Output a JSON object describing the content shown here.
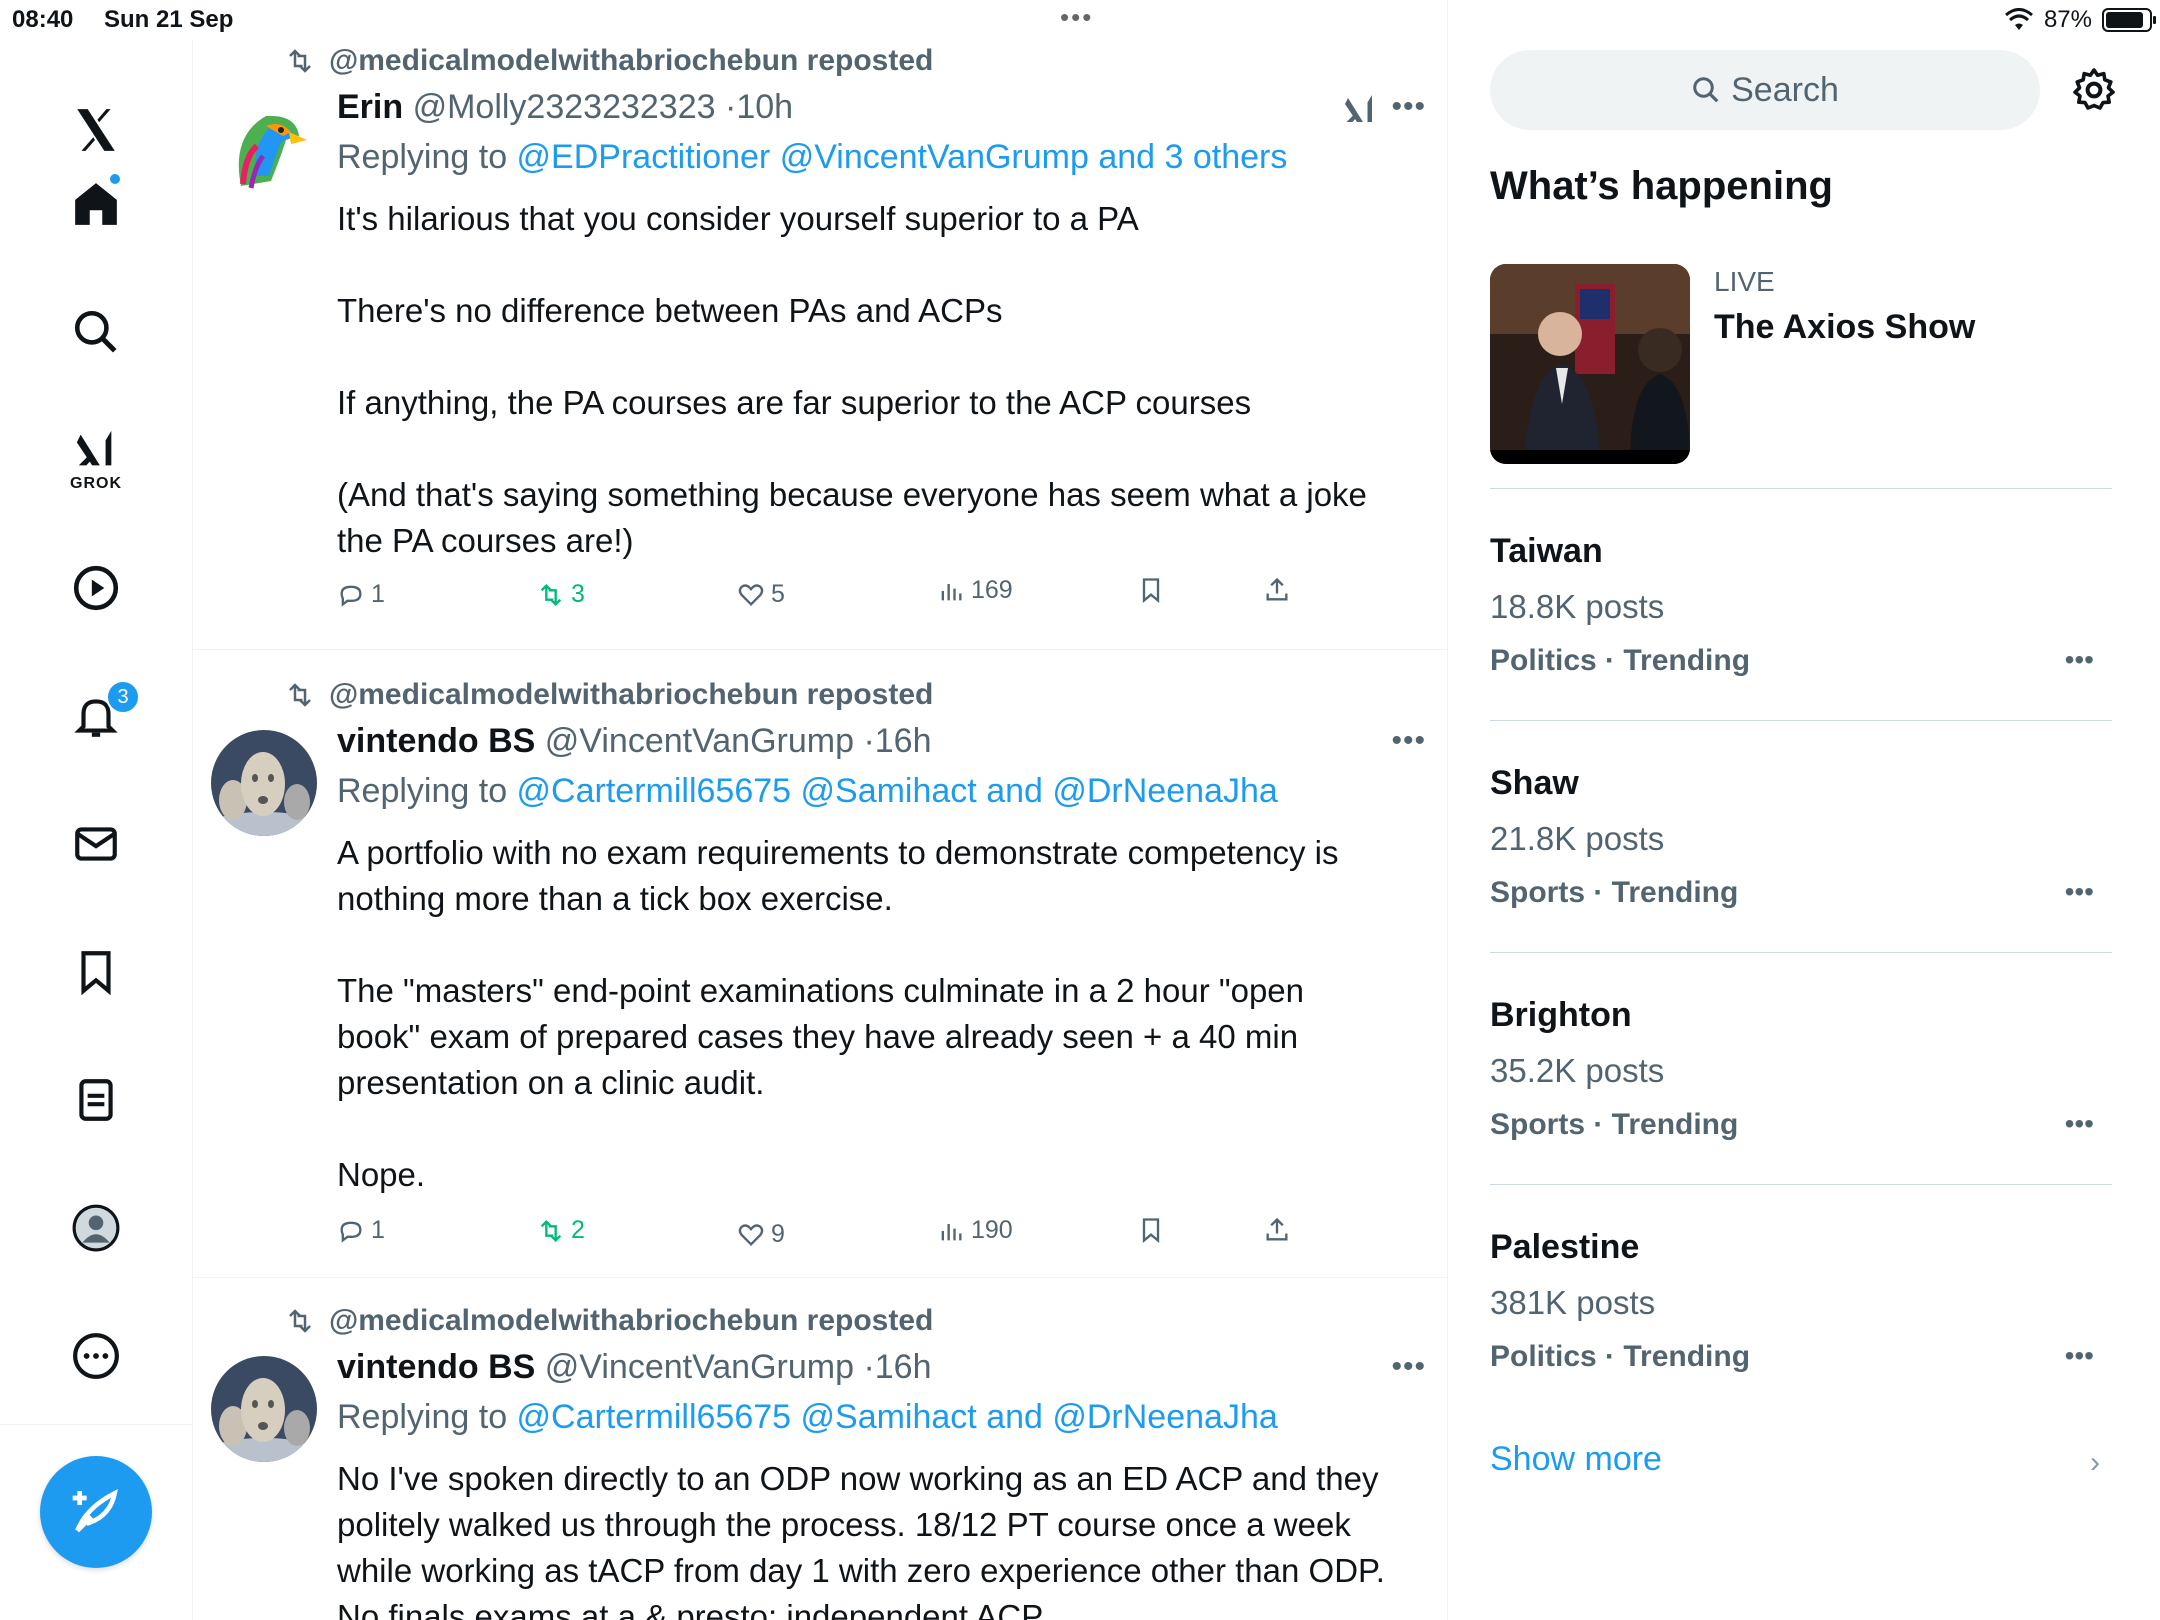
{
  "status_bar": {
    "time": "08:40",
    "date": "Sun 21 Sep",
    "battery": "87%",
    "battery_level": 0.87
  },
  "nav": {
    "grok_label": "GROK",
    "notifications_badge": "3",
    "accent_color": "#1d9bf0"
  },
  "tweets": [
    {
      "repost_label": "@medicalmodelwithabriochebun reposted",
      "name": "Erin",
      "handle": "@Molly2323232323",
      "time": "10h",
      "replying_prefix": "Replying to ",
      "replying_to": "@EDPractitioner @VincentVanGrump and 3 others",
      "text": "It's hilarious that you consider yourself superior to a PA\n\nThere's no difference between PAs and ACPs\n\nIf anything, the PA courses are far superior to the ACP courses\n\n(And that's saying something because everyone has seem what a joke\nthe PA courses are!)",
      "replies": "1",
      "reposts": "3",
      "likes": "5",
      "views": "169"
    },
    {
      "repost_label": "@medicalmodelwithabriochebun reposted",
      "name": "vintendo BS",
      "handle": "@VincentVanGrump",
      "time": "16h",
      "replying_prefix": "Replying to ",
      "replying_to": "@Cartermill65675 @Samihact and @DrNeenaJha",
      "text": "A portfolio with no exam requirements to demonstrate competency is\nnothing more than a tick box exercise.\n\nThe \"masters\" end-point examinations culminate in a 2 hour \"open\nbook\" exam of prepared cases they have already seen + a 40 min\npresentation on a clinic audit.\n\nNope.",
      "replies": "1",
      "reposts": "2",
      "likes": "9",
      "views": "190"
    },
    {
      "repost_label": "@medicalmodelwithabriochebun reposted",
      "name": "vintendo BS",
      "handle": "@VincentVanGrump",
      "time": "16h",
      "replying_prefix": "Replying to ",
      "replying_to": "@Cartermill65675 @Samihact and @DrNeenaJha",
      "text": "No I've spoken directly to an ODP now working as an ED ACP and they\npolitely walked us through the process. 18/12 PT course once a week\nwhile working as tACP from day 1 with zero experience other than ODP.\nNo finals exams at a & presto: independent ACP"
    }
  ],
  "sidebar": {
    "search_placeholder": "Search",
    "section_title": "What’s happening",
    "live": {
      "label": "LIVE",
      "title": "The Axios Show"
    },
    "trends": [
      {
        "name": "Taiwan",
        "count": "18.8K posts",
        "category": "Politics · Trending"
      },
      {
        "name": "Shaw",
        "count": "21.8K posts",
        "category": "Sports · Trending"
      },
      {
        "name": "Brighton",
        "count": "35.2K posts",
        "category": "Sports · Trending"
      },
      {
        "name": "Palestine",
        "count": "381K posts",
        "category": "Politics · Trending"
      }
    ],
    "show_more": "Show more"
  }
}
